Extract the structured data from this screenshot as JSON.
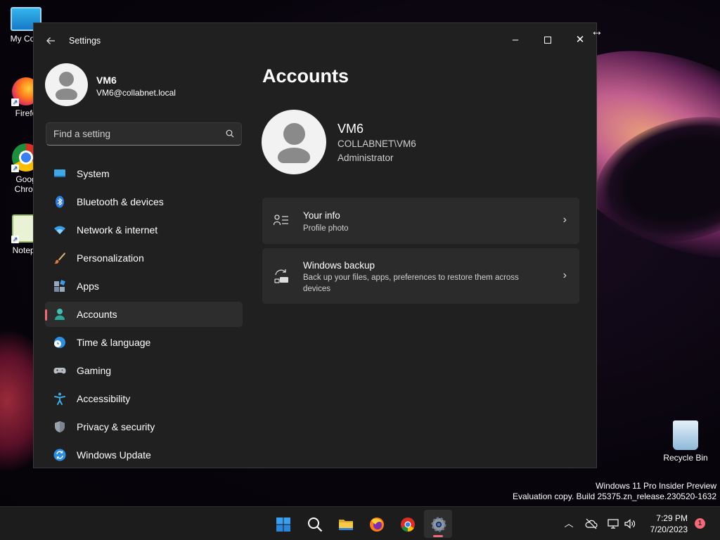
{
  "desktop": {
    "icons": [
      {
        "label": "My Com"
      },
      {
        "label": "Firefo"
      },
      {
        "label": "Goog\nChron"
      },
      {
        "label": "Notepa"
      },
      {
        "label": "Recycle Bin"
      }
    ],
    "watermark": {
      "line1": "Windows 11 Pro Insider Preview",
      "line2": "Evaluation copy. Build 25375.zn_release.230520-1632"
    }
  },
  "window": {
    "title": "Settings",
    "controls": {
      "minimize": "–",
      "close": "✕"
    }
  },
  "sidebar": {
    "user": {
      "name": "VM6",
      "email": "VM6@collabnet.local"
    },
    "search": {
      "placeholder": "Find a setting"
    },
    "items": [
      {
        "label": "System",
        "icon": "system-icon",
        "active": false
      },
      {
        "label": "Bluetooth & devices",
        "icon": "bluetooth-icon",
        "active": false
      },
      {
        "label": "Network & internet",
        "icon": "wifi-icon",
        "active": false
      },
      {
        "label": "Personalization",
        "icon": "brush-icon",
        "active": false
      },
      {
        "label": "Apps",
        "icon": "apps-icon",
        "active": false
      },
      {
        "label": "Accounts",
        "icon": "accounts-icon",
        "active": true
      },
      {
        "label": "Time & language",
        "icon": "time-language-icon",
        "active": false
      },
      {
        "label": "Gaming",
        "icon": "gamepad-icon",
        "active": false
      },
      {
        "label": "Accessibility",
        "icon": "accessibility-icon",
        "active": false
      },
      {
        "label": "Privacy & security",
        "icon": "shield-icon",
        "active": false
      },
      {
        "label": "Windows Update",
        "icon": "update-icon",
        "active": false
      }
    ]
  },
  "main": {
    "page_title": "Accounts",
    "account": {
      "name": "VM6",
      "domain": "COLLABNET\\VM6",
      "role": "Administrator"
    },
    "cards": [
      {
        "title": "Your info",
        "subtitle": "Profile photo"
      },
      {
        "title": "Windows backup",
        "subtitle": "Back up your files, apps, preferences to restore them across devices"
      }
    ]
  },
  "taskbar": {
    "apps": [
      "start-icon",
      "search-icon",
      "file-explorer-icon",
      "firefox-icon",
      "chrome-icon",
      "settings-icon"
    ],
    "active_app": "settings-icon",
    "clock": {
      "time": "7:29 PM",
      "date": "7/20/2023"
    },
    "notifications": "1"
  },
  "colors": {
    "accent": "#f06a78",
    "window_bg": "#202020",
    "card_bg": "#2b2b2b"
  }
}
